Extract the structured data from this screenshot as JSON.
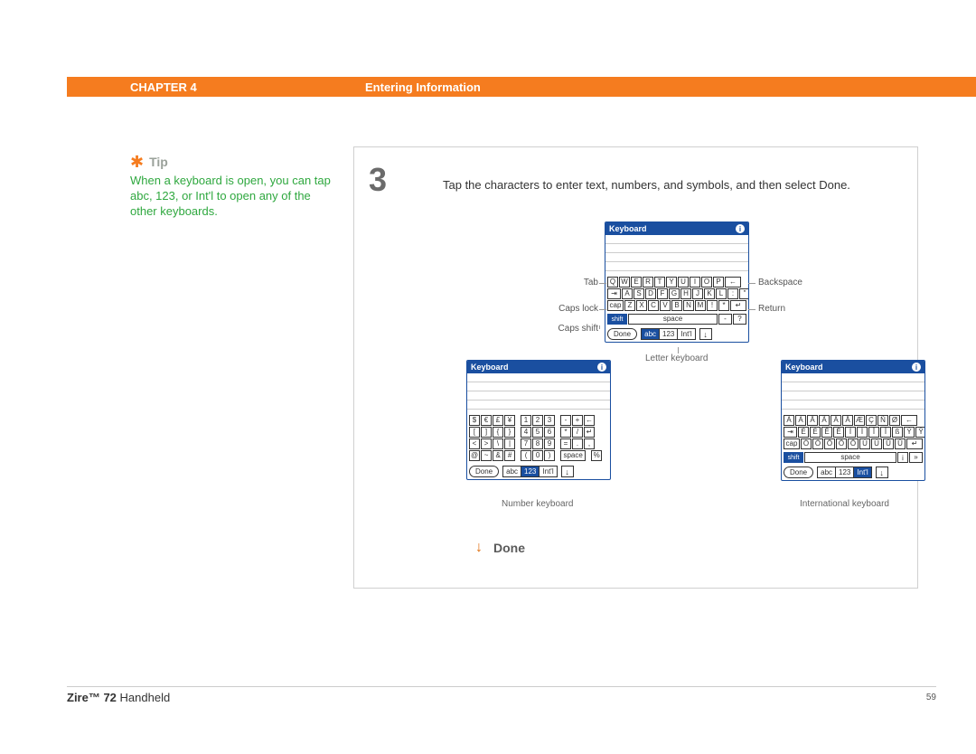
{
  "banner": {
    "chapter": "CHAPTER 4",
    "title": "Entering Information"
  },
  "tip": {
    "label": "Tip",
    "body": "When a keyboard is open, you can tap abc, 123, or Int'l to open any of the other keyboards."
  },
  "step": {
    "number": "3",
    "text": "Tap the characters to enter text, numbers, and symbols, and then select Done."
  },
  "done_label": "Done",
  "callouts": {
    "tab": "Tab",
    "caps_lock": "Caps lock",
    "caps_shift": "Caps shift",
    "backspace": "Backspace",
    "return": "Return",
    "letter_kbd": "Letter keyboard",
    "number_kbd": "Number keyboard",
    "intl_kbd": "International keyboard"
  },
  "kbd": {
    "title": "Keyboard",
    "done": "Done",
    "modes": {
      "abc": "abc",
      "num": "123",
      "intl": "Int'l"
    },
    "shift": "shift",
    "space": "space",
    "cap": "cap"
  },
  "letter_rows": [
    [
      "Q",
      "W",
      "E",
      "R",
      "T",
      "Y",
      "U",
      "I",
      "O",
      "P",
      "←"
    ],
    [
      "A",
      "S",
      "D",
      "F",
      "G",
      "H",
      "J",
      "K",
      "L",
      ":",
      "\""
    ],
    [
      "Z",
      "X",
      "C",
      "V",
      "B",
      "N",
      "M",
      "!",
      "*",
      "↵"
    ]
  ],
  "number_grid": [
    [
      "$",
      "€",
      "£",
      "¥",
      "",
      "1",
      "2",
      "3",
      "",
      "-",
      "+",
      "←"
    ],
    [
      "[",
      "]",
      "{",
      "}",
      "",
      "4",
      "5",
      "6",
      "",
      "*",
      "/",
      "↵"
    ],
    [
      "<",
      ">",
      "\\",
      "|",
      "",
      "7",
      "8",
      "9",
      "",
      "=",
      ".",
      ","
    ],
    [
      "@",
      "~",
      "&",
      "#",
      "",
      "(",
      "0",
      ")",
      "",
      "space",
      "",
      "%"
    ]
  ],
  "intl_rows": [
    [
      "Á",
      "À",
      "Â",
      "Ã",
      "Ä",
      "Å",
      "Æ",
      "Ç",
      "Ñ",
      "Ø",
      "←"
    ],
    [
      "É",
      "È",
      "Ê",
      "Ë",
      "Í",
      "Ì",
      "Î",
      "Ï",
      "ß",
      "Ý",
      "Ÿ"
    ],
    [
      "Ó",
      "Ò",
      "Ô",
      "Õ",
      "Ö",
      "Ú",
      "Ù",
      "Û",
      "Ü",
      "↵"
    ]
  ],
  "footer": {
    "product_bold": "Zire™ 72",
    "product_rest": " Handheld",
    "page": "59"
  }
}
